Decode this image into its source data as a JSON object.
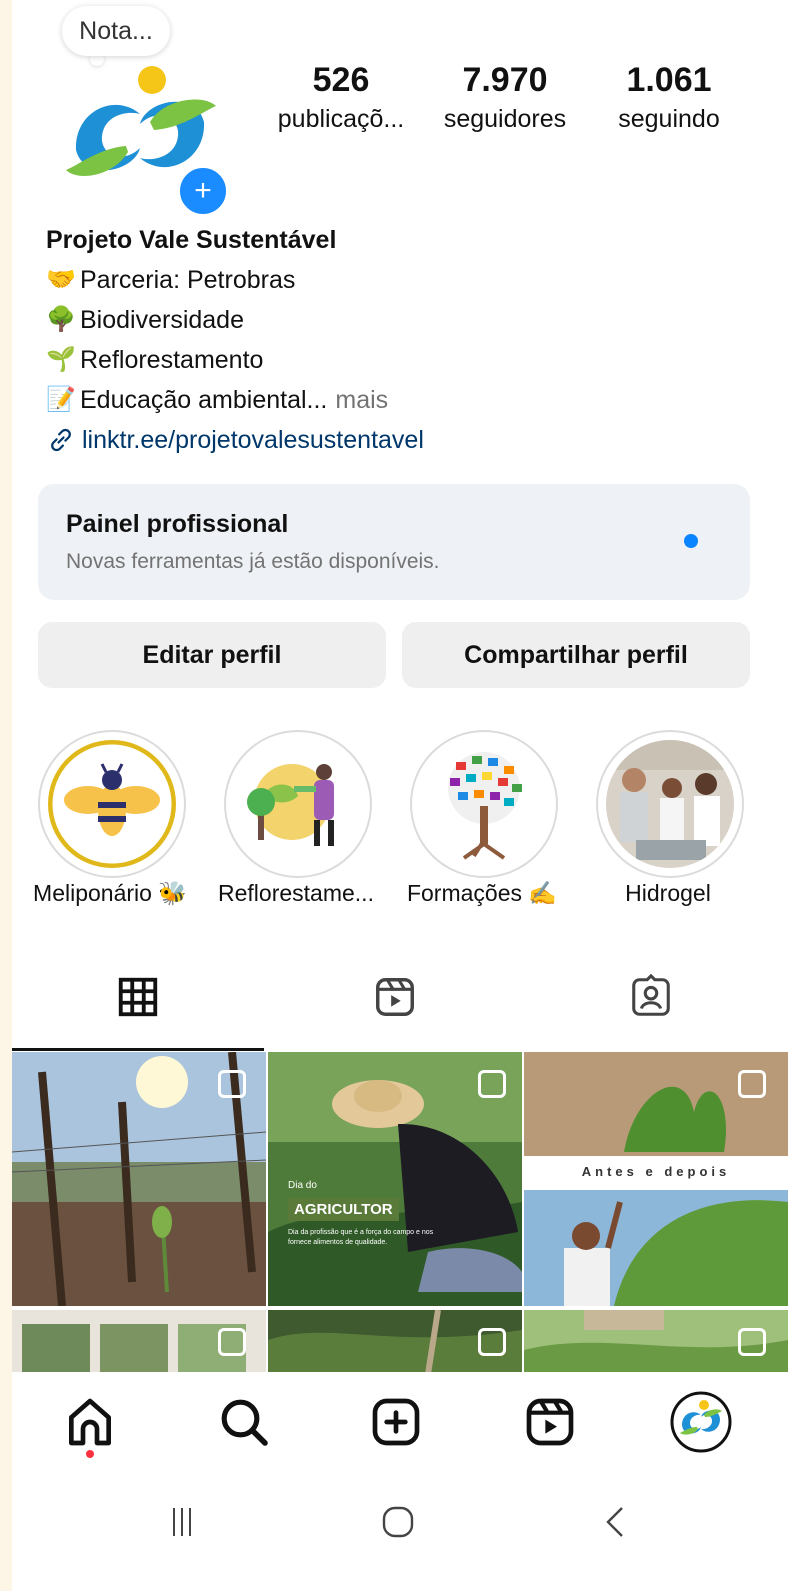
{
  "header": {
    "note_text": "Nota...",
    "add_story_symbol": "+"
  },
  "stats": [
    {
      "value": "526",
      "label": "publicaçõ..."
    },
    {
      "value": "7.970",
      "label": "seguidores"
    },
    {
      "value": "1.061",
      "label": "seguindo"
    }
  ],
  "bio": {
    "name": "Projeto Vale Sustentável",
    "lines": [
      {
        "emoji": "🤝",
        "text": "Parceria: Petrobras"
      },
      {
        "emoji": "🌳",
        "text": "Biodiversidade"
      },
      {
        "emoji": "🌱",
        "text": "Reflorestamento"
      },
      {
        "emoji": "📝",
        "text": "Educação ambiental..."
      }
    ],
    "more_label": "mais",
    "link": "linktr.ee/projetovalesustentavel"
  },
  "professional_panel": {
    "title": "Painel profissional",
    "subtitle": "Novas ferramentas já estão disponíveis."
  },
  "buttons": {
    "edit_profile": "Editar perfil",
    "share_profile": "Compartilhar perfil"
  },
  "highlights": [
    {
      "label": "Meliponário 🐝"
    },
    {
      "label": "Reflorestame..."
    },
    {
      "label": "Formações ✍️"
    },
    {
      "label": "Hidrogel"
    }
  ],
  "tabs": [
    "grid-icon",
    "reels-icon",
    "tagged-icon"
  ],
  "posts": {
    "post2_heading_small": "Dia do",
    "post2_heading": "AGRICULTOR",
    "post2_caption": "Dia da profissão que é a força do campo e nos fornece alimentos de qualidade.",
    "post3_banner": "Antes e depois"
  },
  "bottom_nav": [
    "home-icon",
    "search-icon",
    "create-icon",
    "reels-icon",
    "profile-avatar-icon"
  ],
  "colors": {
    "accent_blue": "#0a84ff",
    "link_blue": "#00376b",
    "button_gray": "#efefef",
    "panel_bg": "#eef1f5",
    "notification_red": "#ff3040"
  }
}
